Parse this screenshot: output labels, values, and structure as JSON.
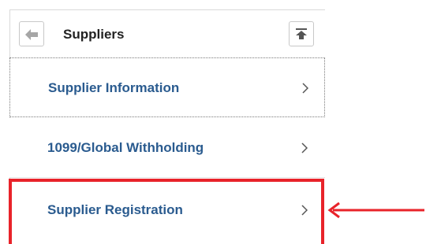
{
  "header": {
    "title": "Suppliers",
    "back_icon": "back-arrow-icon",
    "top_icon": "scroll-to-top-icon"
  },
  "menu": {
    "items": [
      {
        "label": "Supplier Information",
        "icon": "chevron-right-icon"
      },
      {
        "label": "1099/Global Withholding",
        "icon": "chevron-right-icon"
      },
      {
        "label": "Supplier Registration",
        "icon": "chevron-right-icon"
      }
    ]
  },
  "annotation": {
    "color": "#e8232a",
    "arrow_icon": "red-pointer-arrow-icon"
  },
  "colors": {
    "link": "#2a5b8f",
    "title": "#222222"
  }
}
